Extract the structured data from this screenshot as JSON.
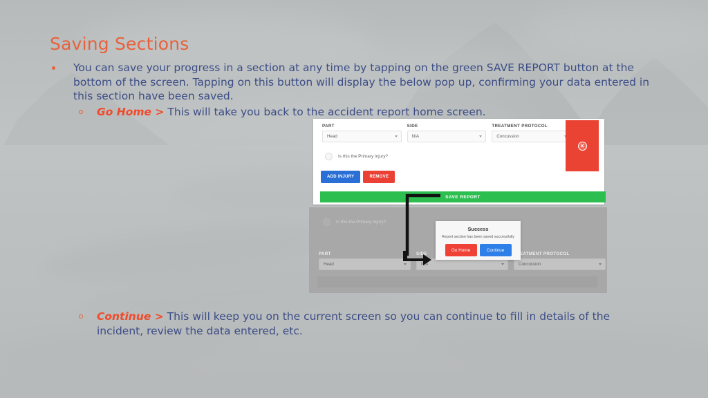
{
  "slide": {
    "title": "Saving Sections",
    "bullets": [
      {
        "level": 1,
        "text": "You can save your progress in a section at any time by tapping on the green SAVE REPORT button at the bottom of the screen. Tapping on this button will display the below pop up, confirming your data entered in this section have been saved."
      },
      {
        "level": 2,
        "keyword": "Go Home >",
        "text": " This will take you back to the accident report home screen."
      },
      {
        "level": 2,
        "keyword": "Continue >",
        "text": " This will keep you on the current screen so you can continue to fill in details of the incident, review the data entered, etc."
      }
    ]
  },
  "colors": {
    "title": "#e8613c",
    "body": "#3c4d86",
    "keyword": "#ef4a2b",
    "save_green": "#2cbf4f",
    "danger_red": "#ea4334",
    "primary_blue": "#2a6fd6"
  },
  "screenshot": {
    "top_form": {
      "fields": [
        {
          "label": "PART",
          "value": "Head"
        },
        {
          "label": "SIDE",
          "value": "N/A"
        },
        {
          "label": "TREATMENT PROTOCOL",
          "value": "Concussion"
        }
      ],
      "checkbox_label": "Is this the Primary Injury?",
      "add_injury_label": "ADD INJURY",
      "remove_label": "REMOVE",
      "close_icon": "close-circle-icon",
      "save_report_label": "SAVE REPORT"
    },
    "bottom_form": {
      "checkbox_label": "Is this the Primary Injury?",
      "fields": [
        {
          "label": "PART",
          "value": "Head"
        },
        {
          "label": "SIDE",
          "value": "N/A"
        },
        {
          "label": "TREATMENT PROTOCOL",
          "value": "Concussion"
        }
      ]
    },
    "modal": {
      "title": "Success",
      "message": "Report section has been saved successfully",
      "go_home_label": "Go Home",
      "continue_label": "Continue"
    }
  }
}
